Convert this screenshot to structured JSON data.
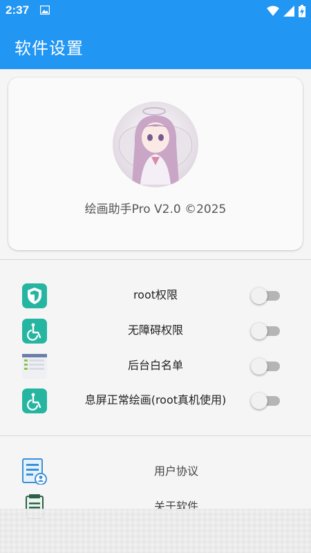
{
  "status_bar": {
    "time": "2:37",
    "icons": [
      "image-icon",
      "wifi-icon",
      "signal-icon",
      "battery-charging-icon"
    ]
  },
  "app_bar": {
    "title": "软件设置"
  },
  "profile": {
    "avatar": "anime-angel-avatar",
    "version_text": "绘画助手Pro V2.0 ©2025"
  },
  "settings": [
    {
      "label": "root权限",
      "icon": "shield-icon",
      "enabled": false
    },
    {
      "label": "无障碍权限",
      "icon": "accessibility-icon",
      "enabled": false
    },
    {
      "label": "后台白名单",
      "icon": "app-list-icon",
      "enabled": false
    },
    {
      "label": "息屏正常绘画(root真机使用)",
      "icon": "accessibility-icon",
      "enabled": false
    }
  ],
  "info_items": [
    {
      "label": "用户协议",
      "icon": "user-agreement-icon"
    },
    {
      "label": "关于软件",
      "icon": "about-icon"
    }
  ],
  "colors": {
    "primary": "#2196f3",
    "icon_teal": "#26b5a0",
    "toggle_off_track": "#b5b5b5",
    "background": "#f5f5f5"
  }
}
